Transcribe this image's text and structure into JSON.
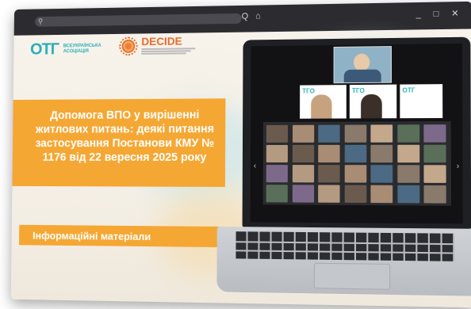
{
  "browser": {
    "search_icon": "search-icon",
    "toolbar_glyphs": "Q ⌂",
    "window_controls": "_ □ ✕"
  },
  "logos": {
    "otg_mark": "ОТГ",
    "otg_line1": "ВСЕУКРАЇНСЬКА",
    "otg_line2": "АСОЦІАЦІЯ",
    "decide_name": "DECIDE"
  },
  "slide": {
    "title": "Допомога ВПО у вирішенні житлових питань: деякі питання застосування Постанови КМУ № 1176 від 22 вересня 2025 року",
    "subtitle": "Інформаційні матеріали"
  },
  "screen": {
    "tile_label": "ТГО",
    "tile_label_2": "ТГО",
    "tile_label_3": "ОТГ"
  },
  "colors": {
    "accent_orange": "#f5a733",
    "brand_teal": "#2bb0b8",
    "decide_orange": "#e46a2b",
    "titlebar": "#2c2c30"
  }
}
